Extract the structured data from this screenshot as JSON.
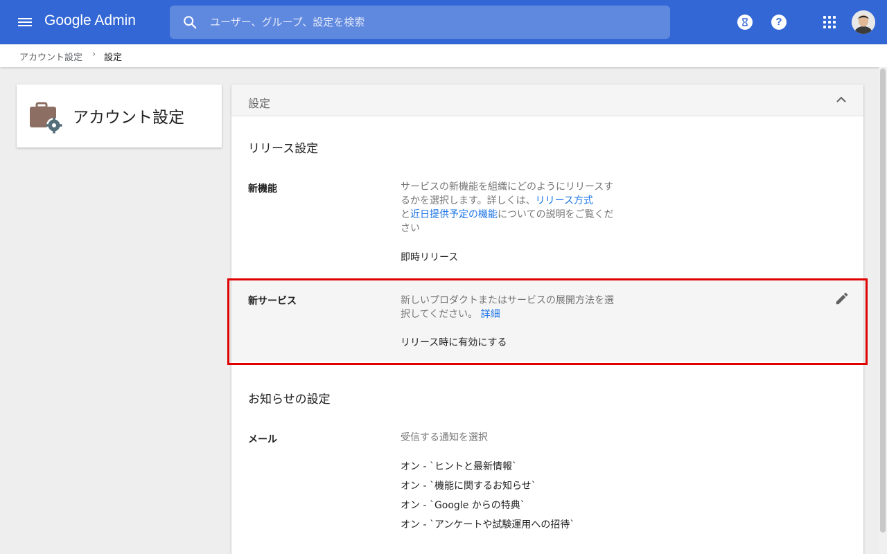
{
  "header": {
    "logo": "Google Admin",
    "search": {
      "placeholder": "ユーザー、グループ、設定を検索"
    }
  },
  "breadcrumb": {
    "items": [
      "アカウント設定",
      "設定"
    ],
    "separator": "›"
  },
  "account_card": {
    "title": "アカウント設定"
  },
  "panel": {
    "title": "設定",
    "release_section": {
      "title": "リリース設定",
      "new_features": {
        "label": "新機能",
        "desc_part1": "サービスの新機能を組織にどのようにリリースするかを選択します。詳しくは、",
        "link1": "リリース方式",
        "desc_part2": "と",
        "link2": "近日提供予定の機能",
        "desc_part3": "についての説明をご覧ください",
        "value": "即時リリース"
      },
      "new_services": {
        "label": "新サービス",
        "desc": "新しいプロダクトまたはサービスの展開方法を選択してください。",
        "link": "詳細",
        "value": "リリース時に有効にする"
      }
    },
    "notification_section": {
      "title": "お知らせの設定",
      "mail": {
        "label": "メール",
        "desc": "受信する通知を選択",
        "values": [
          "オン - `ヒントと最新情報`",
          "オン - `機能に関するお知らせ`",
          "オン - `Google からの特典`",
          "オン - `アンケートや試験運用への招待`"
        ]
      }
    }
  },
  "colors": {
    "header_bg": "#3367d6",
    "link": "#1a73e8",
    "highlight_border": "#e00000"
  }
}
